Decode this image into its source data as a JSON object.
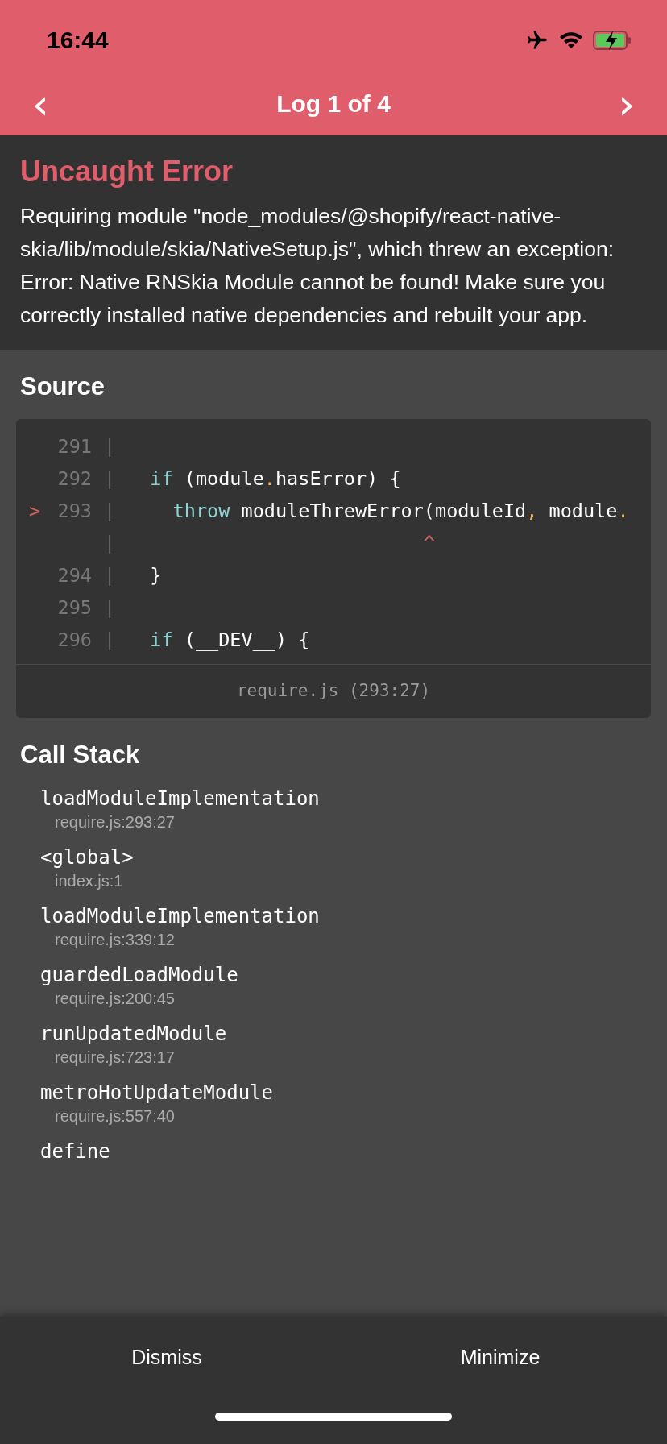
{
  "status_bar": {
    "time": "16:44"
  },
  "nav": {
    "prev": "‹",
    "title": "Log 1 of 4",
    "next": "›"
  },
  "error": {
    "title": "Uncaught Error",
    "message": "Requiring module \"node_modules/@shopify/react-native-skia/lib/module/skia/NativeSetup.js\", which threw an exception: Error: Native RNSkia Module cannot be found! Make sure you correctly installed native dependencies and rebuilt your app."
  },
  "source": {
    "heading": "Source",
    "lines": [
      {
        "number": "291",
        "gutter": "|"
      },
      {
        "number": "292",
        "gutter": "|",
        "segments": [
          {
            "kind": "keyword",
            "text": "  if"
          },
          {
            "kind": "plain",
            "text": " (module"
          },
          {
            "kind": "punct",
            "text": "."
          },
          {
            "kind": "plain",
            "text": "hasError) {"
          }
        ]
      },
      {
        "marker": ">",
        "number": "293",
        "gutter": "|",
        "segments": [
          {
            "kind": "keyword",
            "text": "    throw"
          },
          {
            "kind": "plain",
            "text": " moduleThrewError(moduleId"
          },
          {
            "kind": "punct",
            "text": ","
          },
          {
            "kind": "plain",
            "text": " module"
          },
          {
            "kind": "punct",
            "text": "."
          }
        ]
      },
      {
        "gutter": "|",
        "segments": [
          {
            "kind": "caret",
            "text": "                          ^"
          }
        ]
      },
      {
        "number": "294",
        "gutter": "|",
        "segments": [
          {
            "kind": "plain",
            "text": "  }"
          }
        ]
      },
      {
        "number": "295",
        "gutter": "|"
      },
      {
        "number": "296",
        "gutter": "|",
        "segments": [
          {
            "kind": "keyword",
            "text": "  if"
          },
          {
            "kind": "plain",
            "text": " (__DEV__) {"
          }
        ]
      }
    ],
    "location": "require.js (293:27)"
  },
  "call_stack": {
    "heading": "Call Stack",
    "frames": [
      {
        "method": "loadModuleImplementation",
        "file": "require.js:293:27"
      },
      {
        "method": "<global>",
        "file": "index.js:1"
      },
      {
        "method": "loadModuleImplementation",
        "file": "require.js:339:12"
      },
      {
        "method": "guardedLoadModule",
        "file": "require.js:200:45"
      },
      {
        "method": "runUpdatedModule",
        "file": "require.js:723:17"
      },
      {
        "method": "metroHotUpdateModule",
        "file": "require.js:557:40"
      },
      {
        "method": "define"
      }
    ]
  },
  "footer": {
    "buttons": [
      "Dismiss",
      "Minimize"
    ]
  }
}
